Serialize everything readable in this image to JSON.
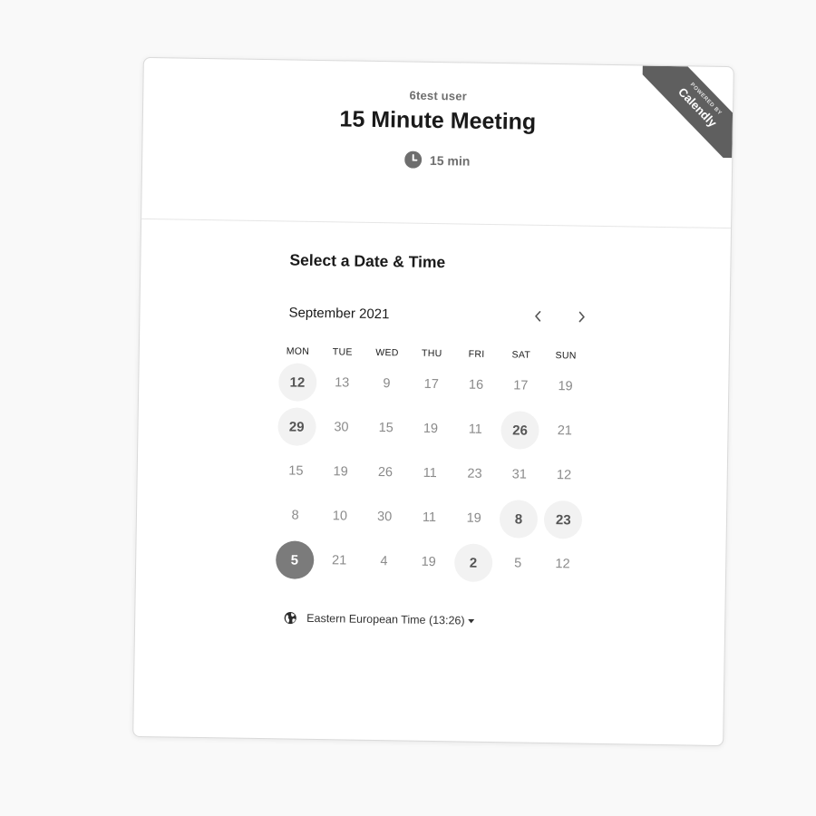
{
  "event": {
    "host": "6test user",
    "title": "15 Minute Meeting",
    "duration": "15 min"
  },
  "ribbon": {
    "small_text": "POWERED BY",
    "brand": "Calendly"
  },
  "calendar": {
    "section_title": "Select a Date & Time",
    "month_label": "September 2021",
    "prev_icon": "chevron-left-icon",
    "next_icon": "chevron-right-icon",
    "weekdays": [
      "MON",
      "TUE",
      "WED",
      "THU",
      "FRI",
      "SAT",
      "SUN"
    ],
    "weeks": [
      [
        {
          "label": "12",
          "state": "available"
        },
        {
          "label": "13",
          "state": "unavailable"
        },
        {
          "label": "9",
          "state": "unavailable"
        },
        {
          "label": "17",
          "state": "unavailable"
        },
        {
          "label": "16",
          "state": "unavailable"
        },
        {
          "label": "17",
          "state": "unavailable"
        },
        {
          "label": "19",
          "state": "unavailable"
        }
      ],
      [
        {
          "label": "29",
          "state": "available"
        },
        {
          "label": "30",
          "state": "unavailable"
        },
        {
          "label": "15",
          "state": "unavailable"
        },
        {
          "label": "19",
          "state": "unavailable"
        },
        {
          "label": "11",
          "state": "unavailable"
        },
        {
          "label": "26",
          "state": "available"
        },
        {
          "label": "21",
          "state": "unavailable"
        }
      ],
      [
        {
          "label": "15",
          "state": "unavailable"
        },
        {
          "label": "19",
          "state": "unavailable"
        },
        {
          "label": "26",
          "state": "unavailable"
        },
        {
          "label": "11",
          "state": "unavailable"
        },
        {
          "label": "23",
          "state": "unavailable"
        },
        {
          "label": "31",
          "state": "unavailable"
        },
        {
          "label": "12",
          "state": "unavailable"
        }
      ],
      [
        {
          "label": "8",
          "state": "unavailable"
        },
        {
          "label": "10",
          "state": "unavailable"
        },
        {
          "label": "30",
          "state": "unavailable"
        },
        {
          "label": "11",
          "state": "unavailable"
        },
        {
          "label": "19",
          "state": "unavailable"
        },
        {
          "label": "8",
          "state": "available"
        },
        {
          "label": "23",
          "state": "available"
        }
      ],
      [
        {
          "label": "5",
          "state": "selected"
        },
        {
          "label": "21",
          "state": "unavailable"
        },
        {
          "label": "4",
          "state": "unavailable"
        },
        {
          "label": "19",
          "state": "unavailable"
        },
        {
          "label": "2",
          "state": "available"
        },
        {
          "label": "5",
          "state": "unavailable"
        },
        {
          "label": "12",
          "state": "unavailable"
        }
      ]
    ]
  },
  "timezone": {
    "label": "Eastern European Time (13:26)",
    "icon": "globe-icon"
  },
  "colors": {
    "ribbon": "#5f5f5f",
    "available_bg": "#f2f2f2",
    "selected_bg": "#7b7b7b",
    "muted_text": "#8a8a8a"
  }
}
